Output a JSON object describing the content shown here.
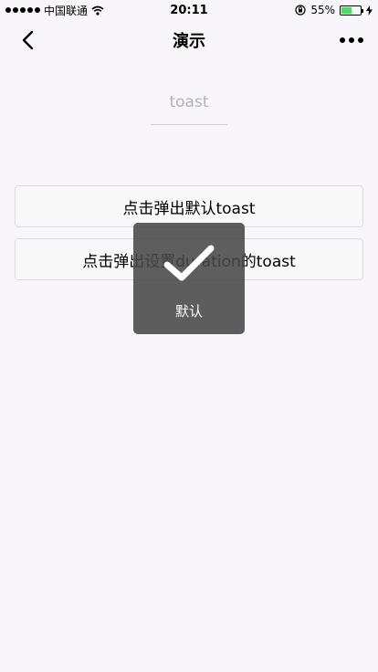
{
  "status_bar": {
    "carrier": "中国联通",
    "time": "20:11",
    "battery_percent": "55%",
    "battery_level": 0.55,
    "icons": [
      "signal-icon",
      "wifi-icon",
      "orientation-lock-icon",
      "battery-icon",
      "charging-icon"
    ]
  },
  "nav": {
    "title": "演示",
    "back_icon": "chevron-left-icon",
    "more_icon": "more-dots-icon"
  },
  "content": {
    "input_label": "toast",
    "buttons": [
      {
        "label": "点击弹出默认toast"
      },
      {
        "label": "点击弹出设置duration的toast"
      }
    ]
  },
  "toast": {
    "icon": "checkmark-icon",
    "text": "默认"
  },
  "colors": {
    "background": "#f8f6fb",
    "battery_fill": "#4cd964",
    "toast_background": "#484848"
  }
}
